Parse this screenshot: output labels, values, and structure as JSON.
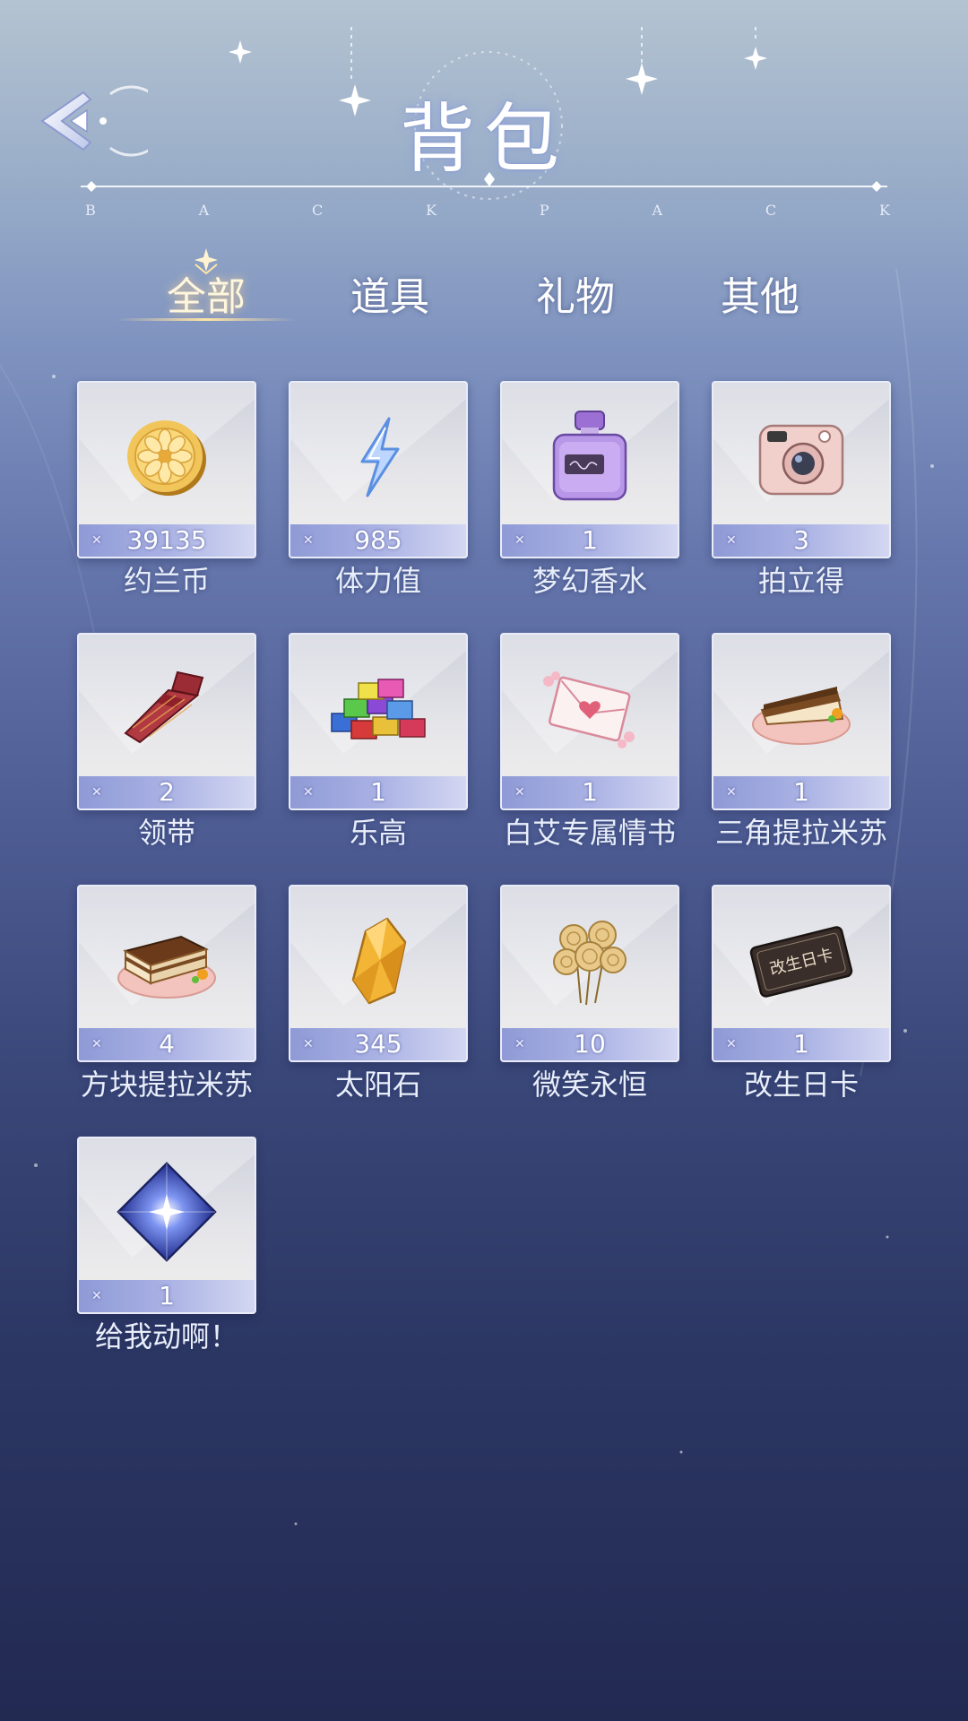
{
  "header": {
    "title": "背包",
    "subtitle_letters": [
      "B",
      "A",
      "C",
      "K",
      "P",
      "A",
      "C",
      "K"
    ]
  },
  "tabs": [
    {
      "label": "全部",
      "active": true
    },
    {
      "label": "道具",
      "active": false
    },
    {
      "label": "礼物",
      "active": false
    },
    {
      "label": "其他",
      "active": false
    }
  ],
  "items": [
    {
      "name": "约兰币",
      "quantity": "39135",
      "icon": "gold-coin-icon"
    },
    {
      "name": "体力值",
      "quantity": "985",
      "icon": "lightning-bolt-icon"
    },
    {
      "name": "梦幻香水",
      "quantity": "1",
      "icon": "perfume-bottle-icon"
    },
    {
      "name": "拍立得",
      "quantity": "3",
      "icon": "instant-camera-icon"
    },
    {
      "name": "领带",
      "quantity": "2",
      "icon": "necktie-icon"
    },
    {
      "name": "乐高",
      "quantity": "1",
      "icon": "building-blocks-icon"
    },
    {
      "name": "白艾专属情书",
      "quantity": "1",
      "icon": "love-letter-icon"
    },
    {
      "name": "三角提拉米苏",
      "quantity": "1",
      "icon": "triangle-tiramisu-icon"
    },
    {
      "name": "方块提拉米苏",
      "quantity": "4",
      "icon": "square-tiramisu-icon"
    },
    {
      "name": "太阳石",
      "quantity": "345",
      "icon": "sun-stone-icon"
    },
    {
      "name": "微笑永恒",
      "quantity": "10",
      "icon": "golden-roses-icon"
    },
    {
      "name": "改生日卡",
      "quantity": "1",
      "icon": "birthday-change-card-icon",
      "card_text": "改生日卡"
    },
    {
      "name": "给我动啊！",
      "quantity": "1",
      "icon": "blue-crystal-icon"
    }
  ],
  "colors": {
    "bg_top": "#b4c3d1",
    "bg_bottom": "#222a52",
    "qty_bar": "#a9b1e3",
    "active_tab": "#fff6dd"
  }
}
